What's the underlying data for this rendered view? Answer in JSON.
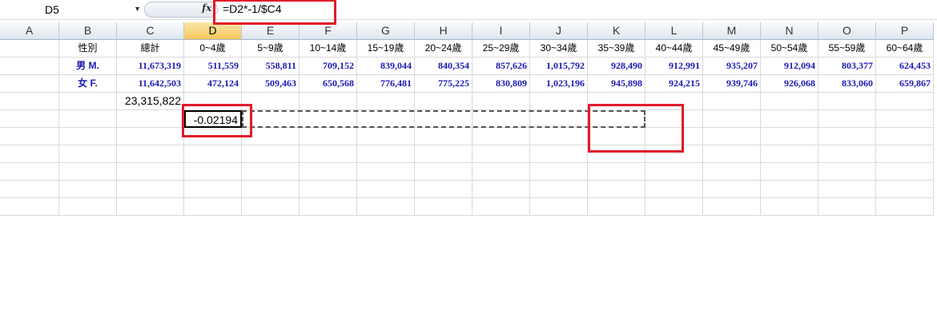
{
  "formula_bar": {
    "name_box": "D5",
    "fx_label": "fx",
    "formula": "=D2*-1/$C4"
  },
  "columns": [
    "A",
    "B",
    "C",
    "D",
    "E",
    "F",
    "G",
    "H",
    "I",
    "J",
    "K",
    "L",
    "M",
    "N",
    "O",
    "P"
  ],
  "selected_column": "D",
  "rows": {
    "header": [
      "",
      "性別",
      "總計",
      "0~4歲",
      "5~9歲",
      "10~14歲",
      "15~19歲",
      "20~24歲",
      "25~29歲",
      "30~34歲",
      "35~39歲",
      "40~44歲",
      "45~49歲",
      "50~54歲",
      "55~59歲",
      "60~64歲"
    ],
    "male": [
      "",
      "男 M.",
      "11,673,319",
      "511,559",
      "558,811",
      "709,152",
      "839,044",
      "840,354",
      "857,626",
      "1,015,792",
      "928,490",
      "912,991",
      "935,207",
      "912,094",
      "803,377",
      "624,453"
    ],
    "female": [
      "",
      "女 F.",
      "11,642,503",
      "472,124",
      "509,463",
      "650,568",
      "776,481",
      "775,225",
      "830,809",
      "1,023,196",
      "945,898",
      "924,215",
      "939,746",
      "926,068",
      "833,060",
      "659,867"
    ],
    "total_row": {
      "C": "23,315,822"
    },
    "active_row": {
      "D": "-0.02194"
    }
  }
}
